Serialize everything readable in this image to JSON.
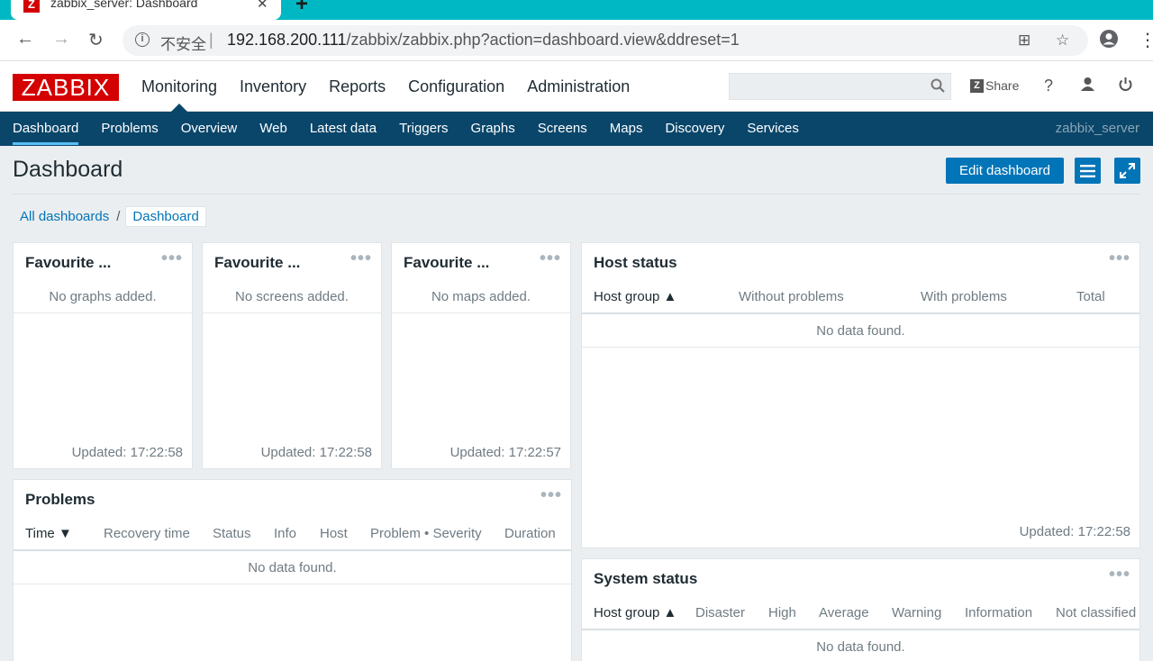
{
  "browser": {
    "tab_title": "zabbix_server: Dashboard",
    "tab_favicon": "Z",
    "insecure_label": "不安全",
    "url_host": "192.168.200.111",
    "url_path": "/zabbix/zabbix.php?action=dashboard.view&ddreset=1"
  },
  "header": {
    "logo": "ZABBIX",
    "menu": [
      "Monitoring",
      "Inventory",
      "Reports",
      "Configuration",
      "Administration"
    ],
    "search_placeholder": "",
    "share_label": "Share",
    "help_label": "?"
  },
  "submenu": {
    "items": [
      "Dashboard",
      "Problems",
      "Overview",
      "Web",
      "Latest data",
      "Triggers",
      "Graphs",
      "Screens",
      "Maps",
      "Discovery",
      "Services"
    ],
    "server_name": "zabbix_server"
  },
  "page": {
    "title": "Dashboard",
    "edit_button": "Edit dashboard"
  },
  "breadcrumb": {
    "all": "All dashboards",
    "sep": "/",
    "current": "Dashboard"
  },
  "widgets": {
    "fav_graphs": {
      "title": "Favourite ...",
      "empty": "No graphs added.",
      "updated": "Updated: 17:22:58"
    },
    "fav_screens": {
      "title": "Favourite ...",
      "empty": "No screens added.",
      "updated": "Updated: 17:22:58"
    },
    "fav_maps": {
      "title": "Favourite ...",
      "empty": "No maps added.",
      "updated": "Updated: 17:22:57"
    },
    "host_status": {
      "title": "Host status",
      "columns": [
        "Host group ▲",
        "Without problems",
        "With problems",
        "Total"
      ],
      "empty": "No data found.",
      "updated": "Updated: 17:22:58"
    },
    "problems": {
      "title": "Problems",
      "columns": [
        "Time ▼",
        "Recovery time",
        "Status",
        "Info",
        "Host",
        "Problem • Severity",
        "Duration"
      ],
      "empty": "No data found."
    },
    "system_status": {
      "title": "System status",
      "columns": [
        "Host group ▲",
        "Disaster",
        "High",
        "Average",
        "Warning",
        "Information",
        "Not classified"
      ],
      "empty": "No data found."
    }
  }
}
